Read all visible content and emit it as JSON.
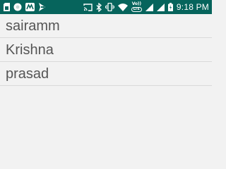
{
  "colors": {
    "status_bar": "#06645c",
    "background": "#f2f2f2",
    "list_text": "#555555",
    "divider": "#d9d9d9"
  },
  "status_bar": {
    "left_icons": [
      "sim-card-icon",
      "circle-notification-icon",
      "mail-app-icon",
      "arrow-notification-icon"
    ],
    "right_icons": [
      "cast-icon",
      "bluetooth-icon",
      "vibrate-icon",
      "wifi-icon",
      "volte-lte-icon",
      "signal-icon",
      "signal-icon",
      "battery-charging-icon"
    ],
    "volte_label": "Vo))",
    "lte_label": "LTE",
    "time": "9:18 PM"
  },
  "list": {
    "items": [
      {
        "label": "sairamm"
      },
      {
        "label": "Krishna"
      },
      {
        "label": "prasad"
      }
    ]
  }
}
